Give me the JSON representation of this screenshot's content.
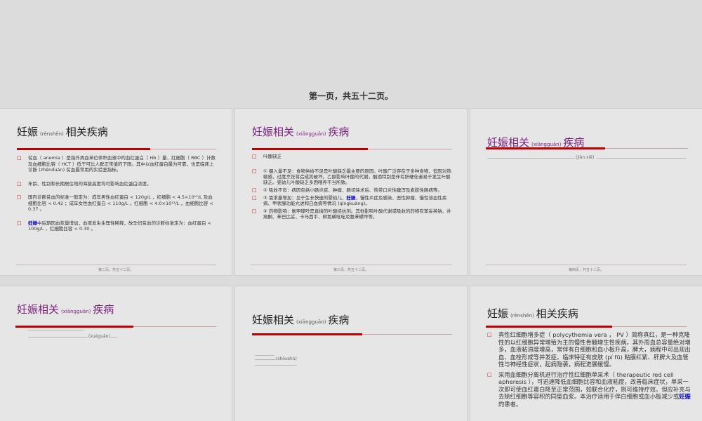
{
  "header": {
    "page_indicator": "第一页，共五十二页。"
  },
  "slides": [
    {
      "title_pre": "妊娠",
      "pinyin": "(rènshēn)",
      "title_post": "相关疾病",
      "bullets": [
        {
          "text": "贫血（ anemia ）是指外周血单位体积血液中的血红蛋白（ Hb ）量、红细胞（ RBC ）计数及血细胞比容（ HCT ）低于可比人群正常值的下限。其中以血红蛋白最为可靠，也是临床上诊断 (zhěnduàn) 贫血最常用的实验室指标。"
        },
        {
          "text": "年龄、性别和长期居住地的海拔高度均可影响血红蛋白浓度。"
        },
        {
          "text": "国内诊断贫血的标准一般定为：成年男性血红蛋白 < 120g/L ，红细胞 < 4.5×10¹²/L 及血细胞比容 < 0.42 ；成年女性血红蛋白 < 110g/L ，红细胞 < 4.0×10¹²/L ，血细胞比容 < 0.37 。"
        },
        {
          "hl": "妊娠",
          "text": "中后期因血浆量增加，血液发生生理性稀释，故孕妇贫血的诊断标准定为：血红蛋白 < 100g/L ，红细胞比容 < 0.30 。"
        }
      ],
      "footer": "第二页，共五十二页。"
    },
    {
      "title_pre": "妊娠相关",
      "pinyin": "(xiāngguān)",
      "title_post": "疾病",
      "bullets": [
        {
          "text": "叶酸缺乏"
        },
        {
          "text": "① 摄入量不足：食物供给不足是叶酸缺乏最主要的原因。叶酸广泛存在于多种食物，但因对热敏感，过度烹饪将造成其破坏。乙醇影响叶酸的代谢，酗酒特别是伴有肝硬化者易于发生叶酸缺乏。婴幼儿叶酸缺乏多因喂养不当所致。"
        },
        {
          "text": "② 吸收不良：病因包括小肠炎症、肿瘤、肠切除术后、热带口炎性腹泻及麦胶性肠病等。"
        },
        {
          "text": "③ 需求量增加：见于生长快速的婴幼儿、",
          "hl": "妊娠",
          "text2": "、慢性炎症及感染、恶性肿瘤、慢性溶血性疾病、甲状腺功能亢进和白血病等情况 (qíngkuàng)。"
        },
        {
          "text": "④ 药物影响：氨甲蝶呤是直接的叶酸拮抗剂。其他影响叶酸代谢或吸收的药物有苯妥英钠、扑痫酮、苯巴比妥、卡马西平、柳氮磺吡啶及氨苯蝶呤等。"
        }
      ],
      "footer": "第三页，共五十二页。"
    },
    {
      "title_pre": "妊娠相关",
      "pinyin": "(xiāngguān)",
      "title_post": "疾病",
      "tiny_pinyin": "(jiān xiē)",
      "footer": "第四页，共五十二页。"
    },
    {
      "title_pre": "妊娠相关",
      "pinyin": "(xiāngguān)",
      "title_post": "疾病",
      "tiny_pinyin": "(xuèguǎn)"
    },
    {
      "title_pre": "妊娠相关",
      "pinyin": "(xiāngguān)",
      "title_post": "疾病",
      "tiny_pinyin": "(shǒushù)"
    },
    {
      "title_pre": "妊娠",
      "pinyin": "(rènshēn)",
      "title_post": "相关疾病",
      "bullets": [
        {
          "text": "真性红细胞增多症（ polycythemia vera ， PV ）简称真红，是一种克隆性的以红细胞异常增殖为主的慢性骨髓增生性疾病。其外周血总容量绝对增多，血液粘滞度增高，常伴有白细胞和血小板升高，脾大，病程中可出现出血、血栓形成等并发症。临床特征有皮肤 (pí fū) 粘膜红紫、肝脾大及血管性与神经性症状，起病隐袭，病程进展缓慢。"
        },
        {
          "text": "采用血细胞分离机进行治疗性红细胞单采术（ therapeutic red cell apheresis ），可迅速降低血细胞比容和血液粘度，改善临床症状，单采一次即可使血红蛋白降至正常范围，如联合化疗，则可维持疗效。但应补充与去除红细胞等容积的同型血浆。本治疗适用于伴白细胞或血小板减少或",
          "hl": "妊娠",
          "text2": "的患者。"
        }
      ]
    }
  ],
  "colors": {
    "accent_red": "#c00000",
    "title_purple": "#7a1f7a",
    "highlight_blue": "#0000cc"
  }
}
